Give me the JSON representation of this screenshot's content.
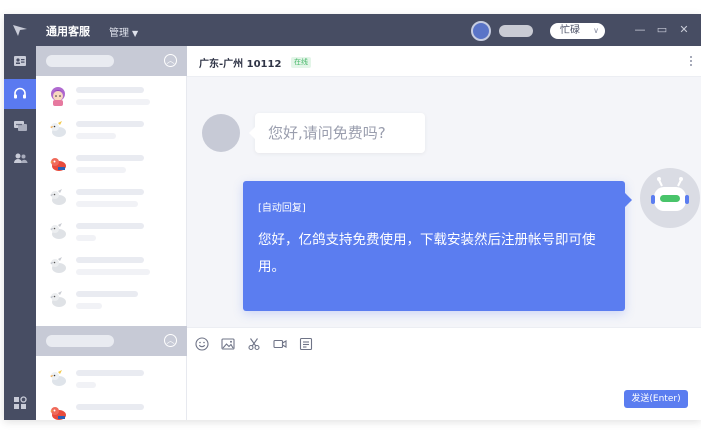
{
  "app": {
    "title": "通用客服",
    "manage_label": "管理",
    "status": "忙碌"
  },
  "colors": {
    "titlebar": "#474d63",
    "accent": "#5b7df0",
    "online": "#48b86a"
  },
  "nav": {
    "items": [
      "logo-icon",
      "id-card-icon",
      "headset-icon",
      "chat-bubbles-icon",
      "contacts-icon"
    ],
    "active": "headset-icon",
    "bottom": "apps-grid-icon"
  },
  "contacts": {
    "groups": 2
  },
  "chat": {
    "title": "广东-广州 10112",
    "online_label": "在线",
    "customer_message": "您好,请问免费吗?",
    "auto_reply_tag": "[自动回复]",
    "auto_reply_text": "您好，亿鸽支持免费使用，下载安装然后注册帐号即可使用。"
  },
  "toolbar": {
    "icons": [
      "emoji-icon",
      "image-icon",
      "scissors-icon",
      "video-icon",
      "note-icon"
    ],
    "send_label": "发送(Enter)"
  }
}
